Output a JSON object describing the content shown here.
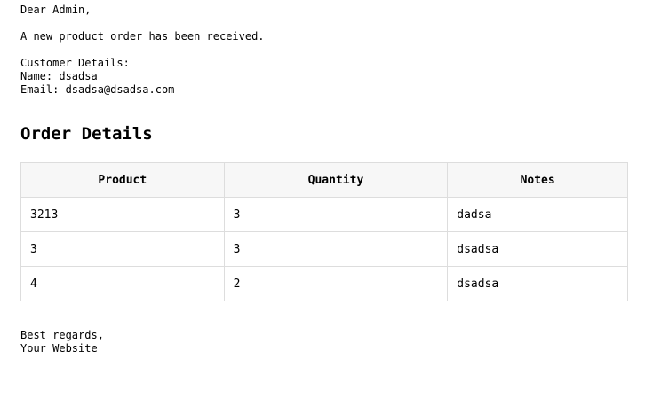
{
  "greeting": "Dear Admin,",
  "intro": "A new product order has been received.",
  "customer": {
    "heading": "Customer Details:",
    "name_line": "Name: dsadsa",
    "email_line": "Email: dsadsa@dsadsa.com"
  },
  "order": {
    "title": "Order Details",
    "columns": [
      "Product",
      "Quantity",
      "Notes"
    ],
    "rows": [
      [
        "3213",
        "3",
        "dadsa"
      ],
      [
        "3",
        "3",
        "dsadsa"
      ],
      [
        "4",
        "2",
        "dsadsa"
      ]
    ]
  },
  "closing": {
    "line1": "Best regards,",
    "line2": "Your Website"
  }
}
